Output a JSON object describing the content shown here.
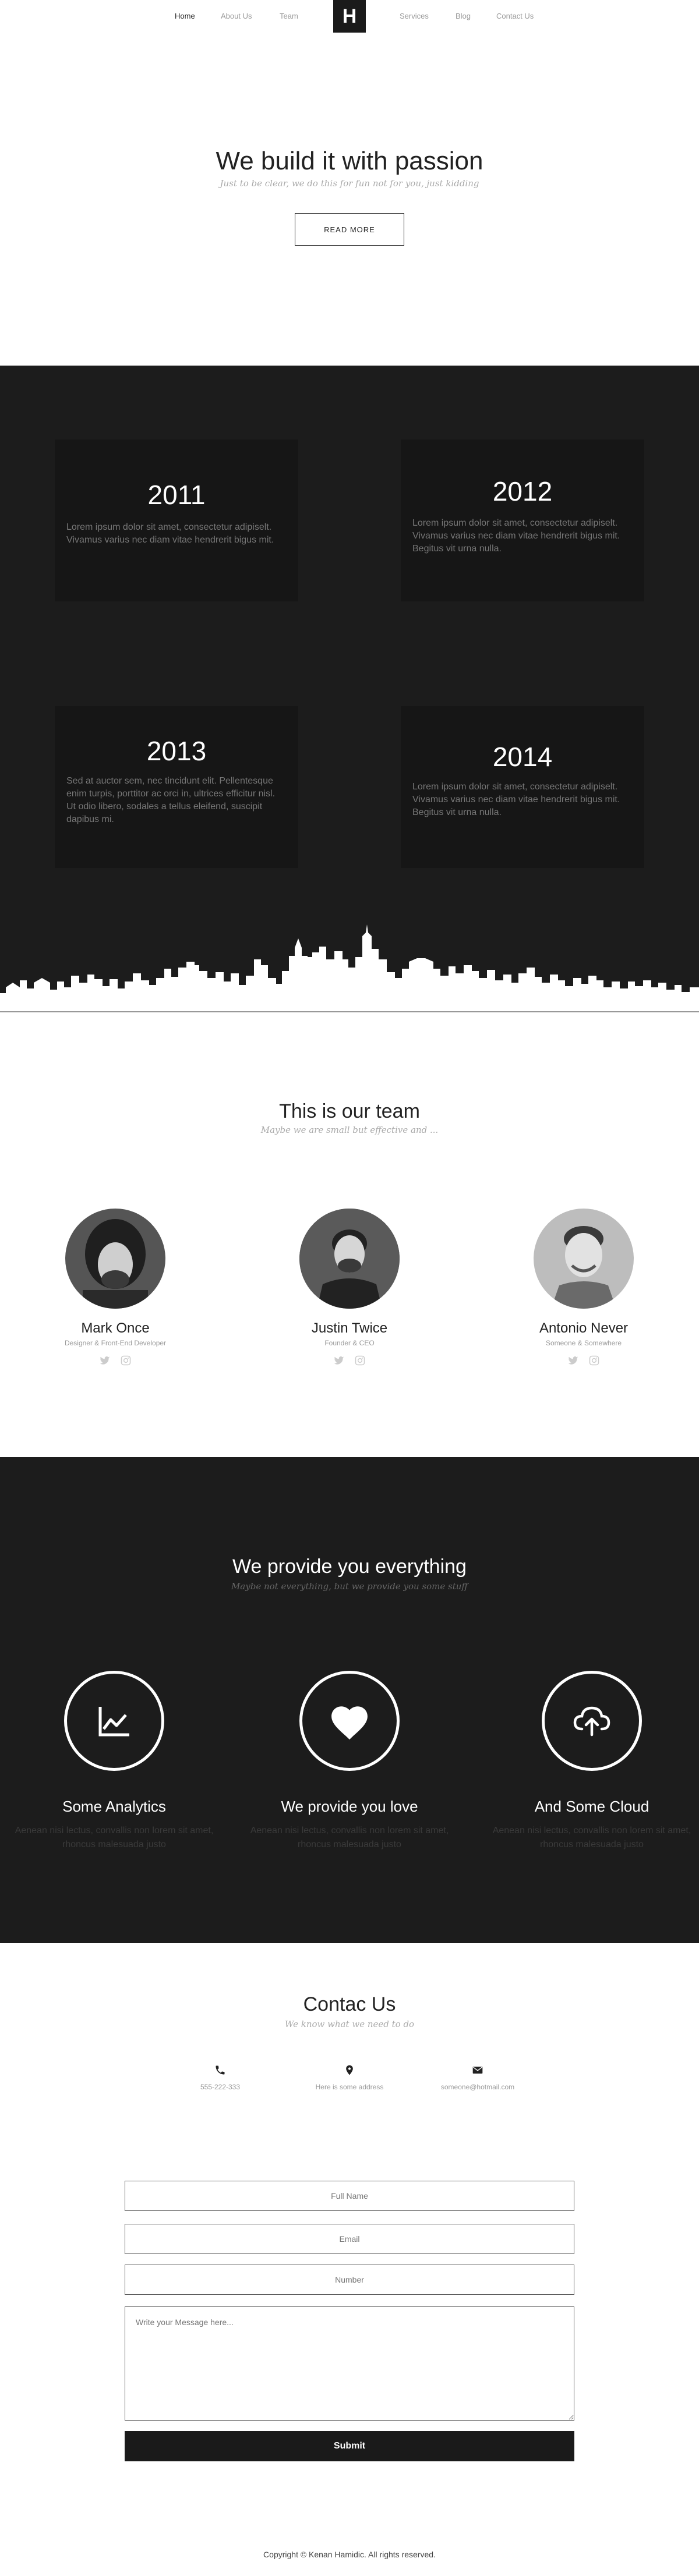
{
  "nav": {
    "logo": "H",
    "items": [
      "Home",
      "About Us",
      "Team",
      "Services",
      "Blog",
      "Contact Us"
    ]
  },
  "hero": {
    "title": "We build it with passion",
    "subtitle": "Just to be clear, we do this for fun not for you, just kidding",
    "button": "READ MORE"
  },
  "timeline": [
    {
      "year": "2011",
      "text": "Lorem ipsum dolor sit amet, consectetur adipiselt. Vivamus varius nec diam vitae hendrerit bigus mit."
    },
    {
      "year": "2012",
      "text": "Lorem ipsum dolor sit amet, consectetur adipiselt. Vivamus varius nec diam vitae hendrerit bigus mit. Begitus vit urna nulla."
    },
    {
      "year": "2013",
      "text": "Sed at auctor sem, nec tincidunt elit. Pellentesque enim turpis, porttitor ac orci in, ultrices efficitur nisl. Ut odio libero, sodales a tellus eleifend, suscipit dapibus mi."
    },
    {
      "year": "2014",
      "text": "Lorem ipsum dolor sit amet, consectetur adipiselt. Vivamus varius nec diam vitae hendrerit bigus mit. Begitus vit urna nulla."
    }
  ],
  "team": {
    "title": "This is our team",
    "subtitle": "Maybe we are small but effective and ...",
    "members": [
      {
        "name": "Mark Once",
        "role": "Designer & Front-End Developer"
      },
      {
        "name": "Justin Twice",
        "role": "Founder & CEO"
      },
      {
        "name": "Antonio Never",
        "role": "Someone & Somewhere"
      }
    ]
  },
  "services": {
    "title": "We provide you everything",
    "subtitle": "Maybe not everything, but we provide you some stuff",
    "items": [
      {
        "icon": "chart-icon",
        "title": "Some Analytics",
        "text": "Aenean nisi lectus, convallis non lorem sit amet, rhoncus malesuada justo"
      },
      {
        "icon": "heart-icon",
        "title": "We provide you love",
        "text": "Aenean nisi lectus, convallis non lorem sit amet, rhoncus malesuada justo"
      },
      {
        "icon": "cloud-upload-icon",
        "title": "And Some Cloud",
        "text": "Aenean nisi lectus, convallis non lorem sit amet, rhoncus malesuada justo"
      }
    ]
  },
  "contact": {
    "title": "Contac Us",
    "subtitle": "We know what we need to do",
    "info": [
      {
        "icon": "phone-icon",
        "text": "555-222-333"
      },
      {
        "icon": "location-pin-icon",
        "text": "Here is some address"
      },
      {
        "icon": "envelope-icon",
        "text": "someone@hotmail.com"
      }
    ],
    "form": {
      "name_placeholder": "Full Name",
      "email_placeholder": "Email",
      "number_placeholder": "Number",
      "message_placeholder": "Write your Message here...",
      "submit": "Submit"
    }
  },
  "footer": {
    "copyright": "Copyright © Kenan Hamidic. All rights reserved."
  },
  "colors": {
    "dark": "#1c1c1c",
    "card": "#161616",
    "accent": "#1a1a1a"
  }
}
